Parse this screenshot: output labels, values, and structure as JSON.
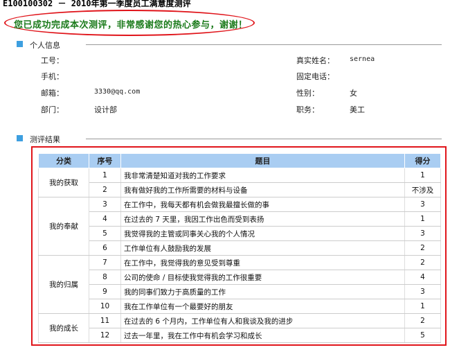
{
  "page_title": "E100100302 － 2010年第一季度员工满意度测评",
  "success_message": "您已成功完成本次测评，非常感谢您的热心参与，谢谢！",
  "personal_info": {
    "section_label": "个人信息",
    "fields": {
      "employee_id": {
        "label": "工号：",
        "value": ""
      },
      "real_name": {
        "label": "真实姓名：",
        "value": "sernea"
      },
      "mobile": {
        "label": "手机：",
        "value": ""
      },
      "phone": {
        "label": "固定电话：",
        "value": ""
      },
      "email": {
        "label": "邮箱：",
        "value": "3330@qq.com"
      },
      "gender": {
        "label": "性别：",
        "value": "女"
      },
      "department": {
        "label": "部门：",
        "value": "设计部"
      },
      "position": {
        "label": "职务：",
        "value": "美工"
      }
    }
  },
  "results": {
    "section_label": "测评结果",
    "headers": {
      "category": "分类",
      "seq": "序号",
      "question": "题目",
      "score": "得分"
    },
    "groups": [
      {
        "category": "我的获取",
        "rows": [
          {
            "seq": "1",
            "question": "我非常清楚知道对我的工作要求",
            "score": "1"
          },
          {
            "seq": "2",
            "question": "我有做好我的工作所需要的材料与设备",
            "score": "不涉及"
          }
        ]
      },
      {
        "category": "我的奉献",
        "rows": [
          {
            "seq": "3",
            "question": "在工作中，我每天都有机会做我最擅长做的事",
            "score": "3"
          },
          {
            "seq": "4",
            "question": "在过去的 7 天里，我因工作出色而受到表扬",
            "score": "1"
          },
          {
            "seq": "5",
            "question": "我觉得我的主管或同事关心我的个人情况",
            "score": "3"
          },
          {
            "seq": "6",
            "question": "工作单位有人鼓励我的发展",
            "score": "2"
          }
        ]
      },
      {
        "category": "我的归属",
        "rows": [
          {
            "seq": "7",
            "question": "在工作中，我觉得我的意见受到尊重",
            "score": "2"
          },
          {
            "seq": "8",
            "question": "公司的使命 / 目标使我觉得我的工作很重要",
            "score": "4"
          },
          {
            "seq": "9",
            "question": "我的同事们致力于高质量的工作",
            "score": "3"
          },
          {
            "seq": "10",
            "question": "我在工作单位有一个最要好的朋友",
            "score": "1"
          }
        ]
      },
      {
        "category": "我的成长",
        "rows": [
          {
            "seq": "11",
            "question": "在过去的 6 个月内，工作单位有人和我谈及我的进步",
            "score": "2"
          },
          {
            "seq": "12",
            "question": "过去一年里，我在工作中有机会学习和成长",
            "score": "5"
          }
        ]
      }
    ]
  },
  "colors": {
    "accent": "#3d9fe0",
    "header_bg": "#a9cdf2",
    "highlight": "#e0141a",
    "success": "#1a7a1a"
  }
}
